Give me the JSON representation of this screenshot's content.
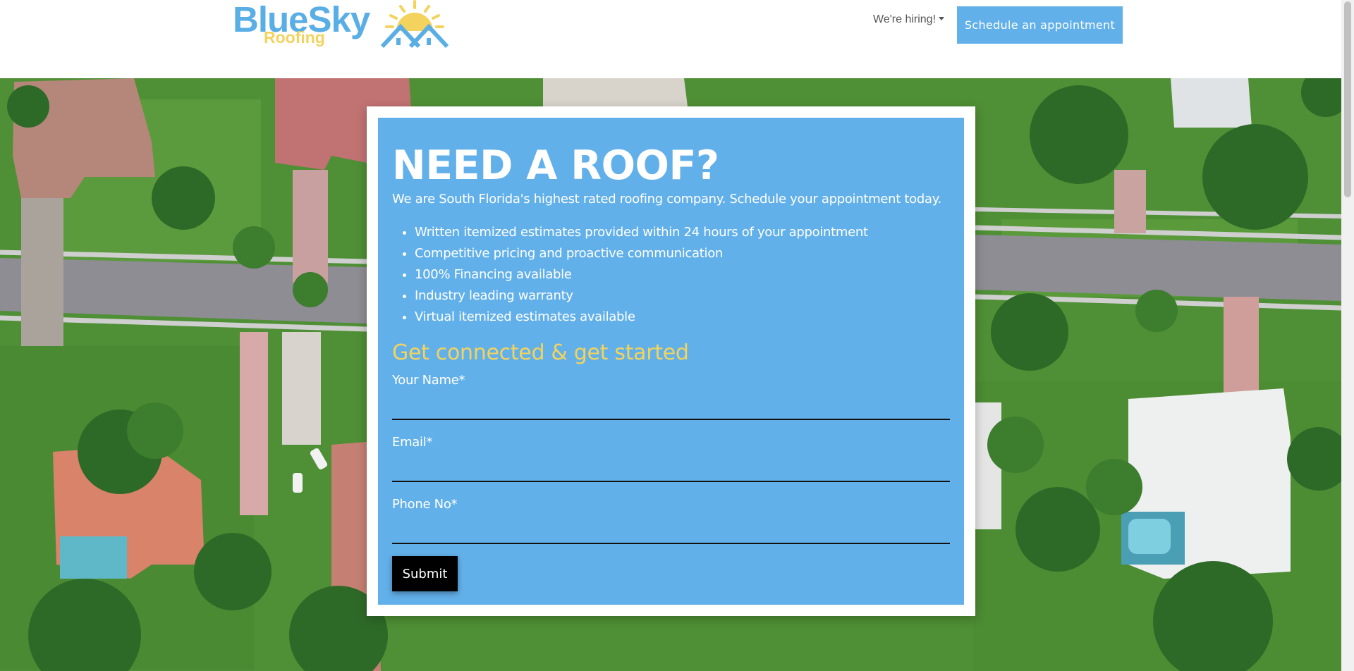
{
  "brand": {
    "name": "BlueSky",
    "tagline": "Roofing",
    "colors": {
      "primary": "#62b0ea",
      "accent": "#f3d35d",
      "button": "#000000"
    }
  },
  "nav": {
    "hiring_label": "We're hiring!",
    "cta_label": "Schedule an appointment"
  },
  "hero": {
    "headline": "NEED A ROOF?",
    "intro": "We are South Florida's highest rated roofing company. Schedule your appointment today.",
    "benefits": [
      "Written itemized estimates provided within 24 hours of your appointment",
      "Competitive pricing and proactive communication",
      "100% Financing available",
      "Industry leading warranty",
      "Virtual itemized estimates available"
    ],
    "form_title": "Get connected & get started"
  },
  "form": {
    "name_label": "Your Name*",
    "name_value": "",
    "email_label": "Email*",
    "email_value": "",
    "phone_label": "Phone No*",
    "phone_value": "",
    "submit_label": "Submit"
  },
  "icons": {
    "logo_mark": "sun-over-house-icon",
    "hiring_caret": "caret-down-icon"
  }
}
